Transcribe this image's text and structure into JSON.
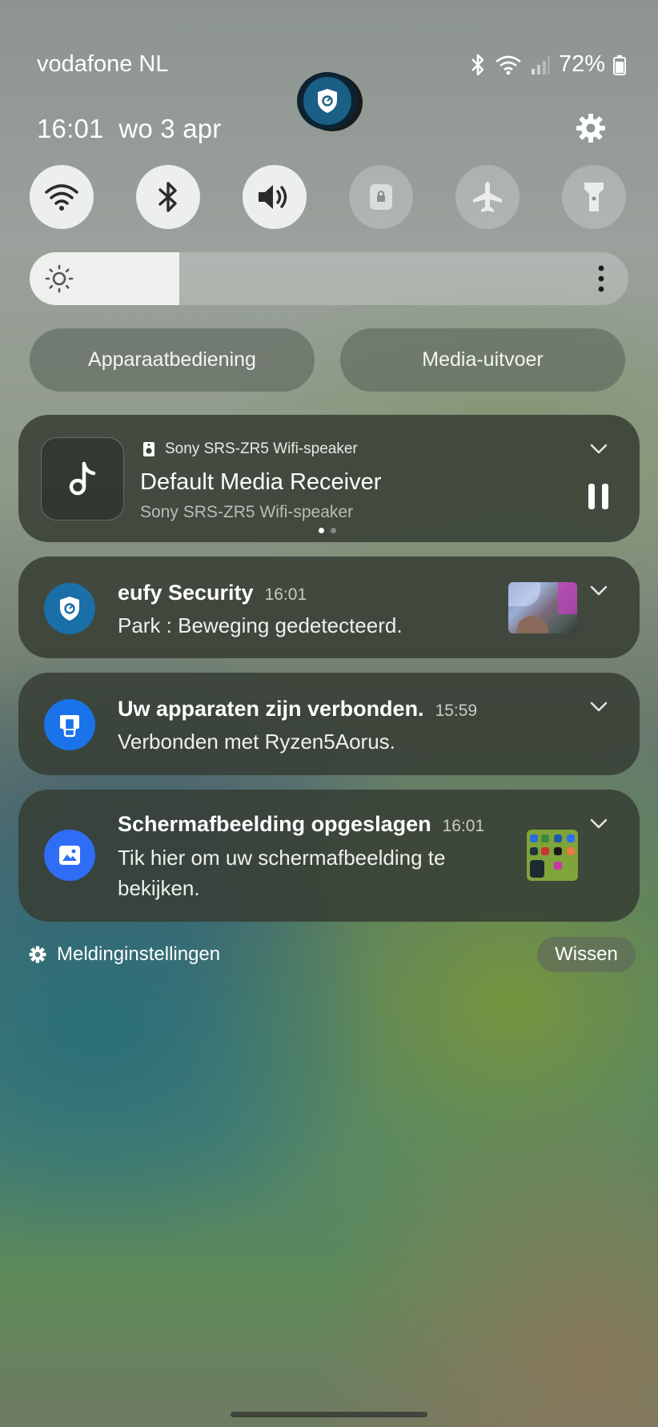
{
  "status_bar": {
    "carrier": "vodafone NL",
    "battery": "72%",
    "icons": [
      "bluetooth-icon",
      "wifi-icon",
      "signal-icon",
      "battery-icon"
    ]
  },
  "header": {
    "datetime": "16:01  wo 3 apr",
    "settings_icon": "gear-icon"
  },
  "quick_settings": [
    {
      "name": "wifi",
      "icon": "wifi-icon",
      "active": true
    },
    {
      "name": "bluetooth",
      "icon": "bluetooth-icon",
      "active": true
    },
    {
      "name": "sound",
      "icon": "volume-icon",
      "active": true
    },
    {
      "name": "lock",
      "icon": "lock-icon",
      "active": false
    },
    {
      "name": "airplane",
      "icon": "airplane-icon",
      "active": false
    },
    {
      "name": "flashlight",
      "icon": "flashlight-icon",
      "active": false
    }
  ],
  "brightness": {
    "level": 0.25
  },
  "buttons": {
    "device_control": "Apparaatbediening",
    "media_output": "Media-uitvoer"
  },
  "media": {
    "source": "Sony SRS-ZR5 Wifi-speaker",
    "title": "Default Media Receiver",
    "subtitle": "Sony SRS-ZR5 Wifi-speaker"
  },
  "notifications": [
    {
      "app": "eufy Security",
      "time": "16:01",
      "body": "Park : Beweging gedetecteerd.",
      "icon": "eufy-shield-icon",
      "color": "#1b6fa8"
    },
    {
      "app": "Uw apparaten zijn verbonden.",
      "time": "15:59",
      "body": "Verbonden met Ryzen5Aorus.",
      "icon": "phone-link-icon",
      "color": "#1a73e8"
    },
    {
      "app": "Schermafbeelding opgeslagen",
      "time": "16:01",
      "body": "Tik hier om uw schermafbeelding te bekijken.",
      "icon": "image-icon",
      "color": "#2f6df6"
    }
  ],
  "footer": {
    "settings_label": "Meldinginstellingen",
    "clear_label": "Wissen"
  }
}
